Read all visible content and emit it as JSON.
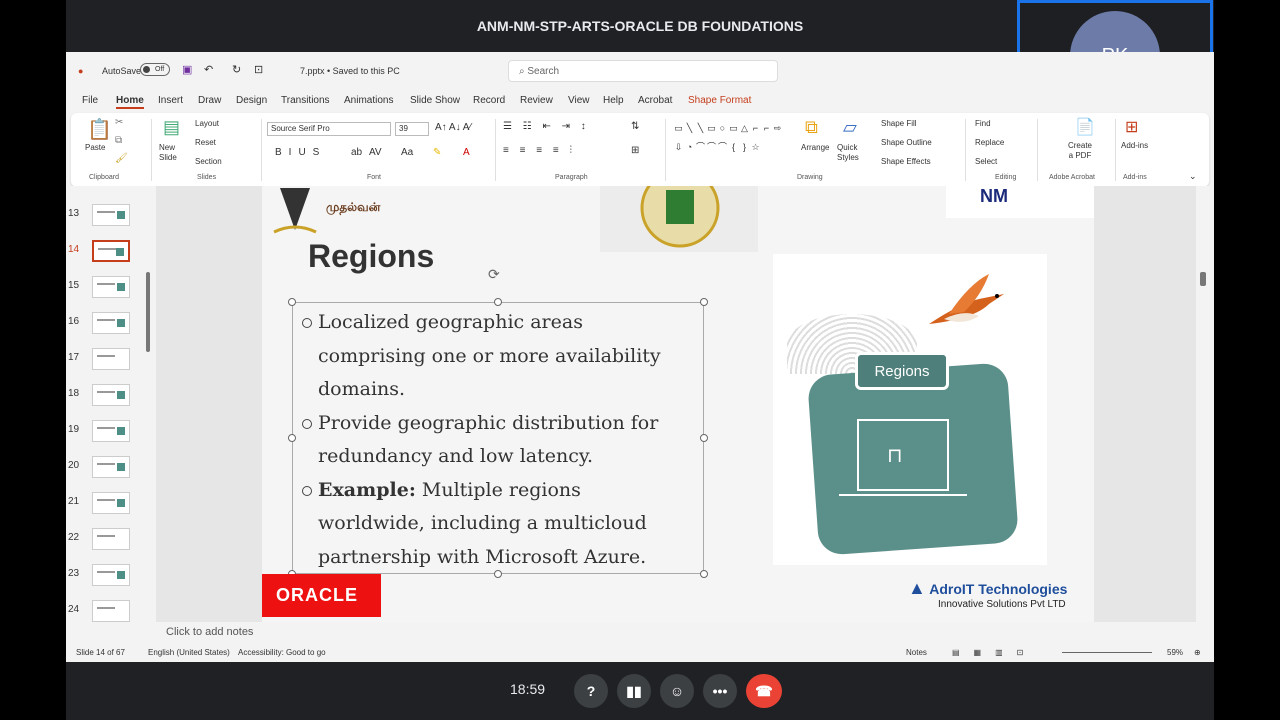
{
  "meeting": {
    "title": "ANM-NM-STP-ARTS-ORACLE DB FOUNDATIONS",
    "participant_initials": "PK",
    "time": "18:59",
    "accent": "#1a73e8",
    "end_color": "#ea4335"
  },
  "ppt": {
    "autosave_label": "AutoSave",
    "autosave_state": "Off",
    "file_status": "7.pptx • Saved to this PC",
    "search_placeholder": "Search",
    "tabs": [
      "File",
      "Home",
      "Insert",
      "Draw",
      "Design",
      "Transitions",
      "Animations",
      "Slide Show",
      "Record",
      "Review",
      "View",
      "Help",
      "Acrobat",
      "Shape Format"
    ],
    "ribbon": {
      "paste": "Paste",
      "new_slide": "New Slide",
      "layout": "Layout",
      "reset": "Reset",
      "section": "Section",
      "font_name": "Source Serif Pro",
      "font_size": "39",
      "arrange": "Arrange",
      "quick_styles": "Quick Styles",
      "shape_fill": "Shape Fill",
      "shape_outline": "Shape Outline",
      "shape_effects": "Shape Effects",
      "find": "Find",
      "replace": "Replace",
      "select": "Select",
      "create_pdf": "Create a PDF",
      "addins": "Add-ins",
      "groups": {
        "clipboard": "Clipboard",
        "slides": "Slides",
        "font": "Font",
        "paragraph": "Paragraph",
        "drawing": "Drawing",
        "editing": "Editing",
        "adobe": "Adobe Acrobat",
        "addins": "Add-ins"
      }
    },
    "thumbnails": [
      "13",
      "14",
      "15",
      "16",
      "17",
      "18",
      "19",
      "20",
      "21",
      "22",
      "23",
      "24"
    ],
    "selected_slide": "14",
    "slide": {
      "title": "Regions",
      "bullet1": "Localized geographic areas comprising one or more availability domains.",
      "bullet2": "Provide geographic distribution for redundancy and low latency.",
      "bullet3_bold": "Example:",
      "bullet3_rest": " Multiple regions worldwide, including a multicloud partnership with Microsoft Azure.",
      "oracle_logo": "ORACLE",
      "illustration_label": "Regions",
      "logo_tl_text": "முதல்வன்",
      "logo_tr_text": "NM",
      "company_name": "AdroIT Technologies",
      "company_tagline": "Innovative Solutions Pvt LTD",
      "accent_teal": "#5b8f89",
      "oracle_red": "#ee1111"
    },
    "notes_placeholder": "Click to add notes",
    "status": {
      "slide_count": "Slide 14 of 67",
      "language": "English (United States)",
      "accessibility": "Accessibility: Good to go",
      "notes": "Notes",
      "zoom": "59%"
    }
  }
}
